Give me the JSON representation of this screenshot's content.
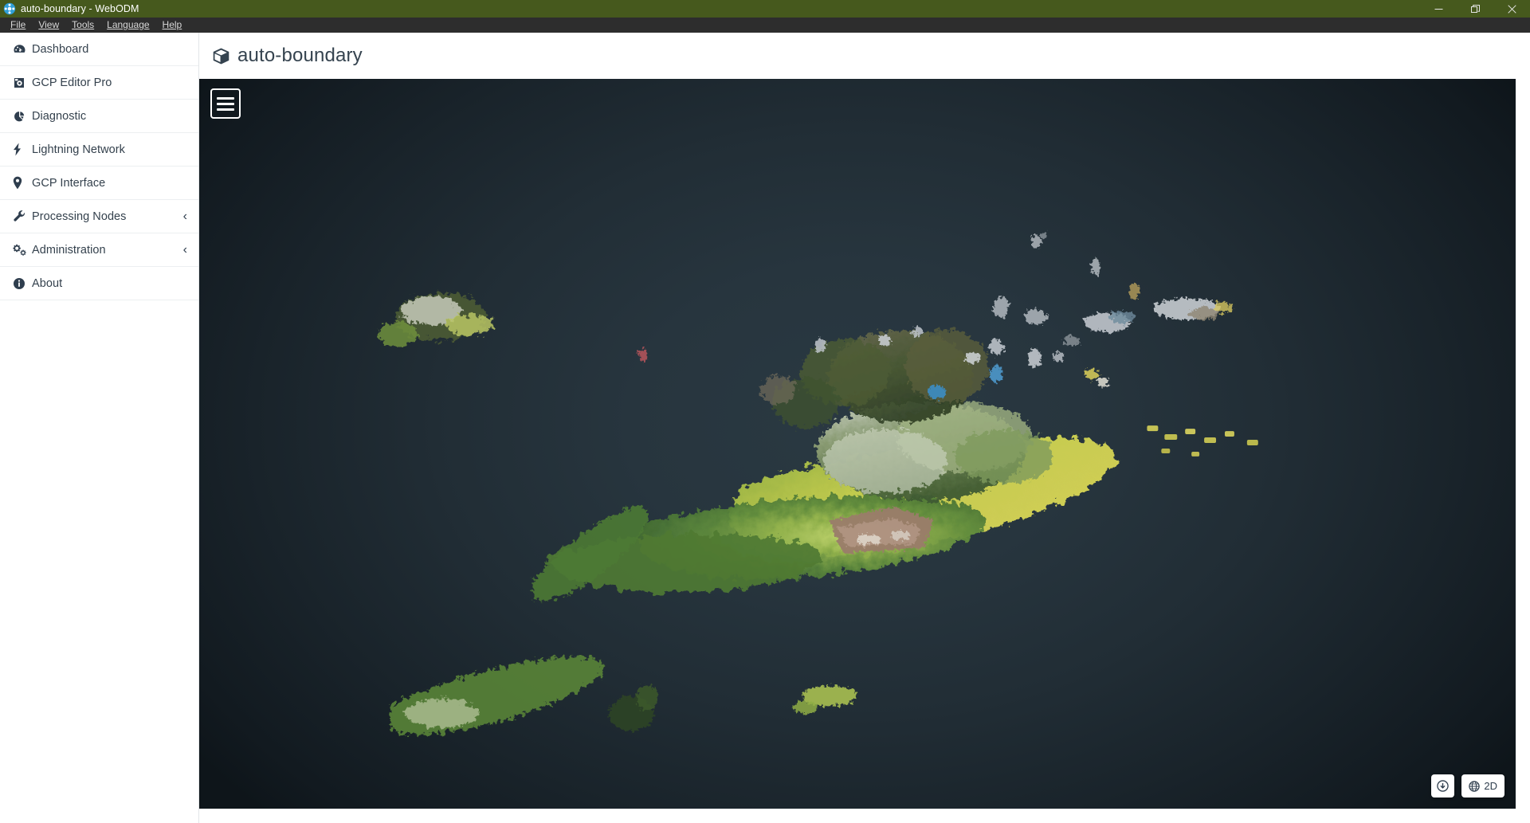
{
  "window": {
    "title": "auto-boundary - WebODM",
    "app_icon": "webodm-logo-icon",
    "controls": {
      "minimize": "minimize-icon",
      "maximize": "restore-icon",
      "close": "close-icon"
    }
  },
  "menubar": {
    "items": [
      {
        "label": "File"
      },
      {
        "label": "View"
      },
      {
        "label": "Tools"
      },
      {
        "label": "Language"
      },
      {
        "label": "Help"
      }
    ]
  },
  "sidebar": {
    "items": [
      {
        "label": "Dashboard",
        "icon": "dashboard-icon",
        "chevron": ""
      },
      {
        "label": "GCP Editor Pro",
        "icon": "gcp-editor-icon",
        "chevron": ""
      },
      {
        "label": "Diagnostic",
        "icon": "pie-chart-icon",
        "chevron": ""
      },
      {
        "label": "Lightning Network",
        "icon": "bolt-icon",
        "chevron": ""
      },
      {
        "label": "GCP Interface",
        "icon": "map-marker-icon",
        "chevron": ""
      },
      {
        "label": "Processing Nodes",
        "icon": "wrench-icon",
        "chevron": "‹"
      },
      {
        "label": "Administration",
        "icon": "cogs-icon",
        "chevron": "‹"
      },
      {
        "label": "About",
        "icon": "info-circle-icon",
        "chevron": ""
      }
    ]
  },
  "page": {
    "title": "auto-boundary",
    "icon": "cube-icon"
  },
  "viewer": {
    "menu_button": "hamburger-menu-icon",
    "buttons": [
      {
        "icon": "download-circle-icon",
        "label": ""
      },
      {
        "icon": "globe-icon",
        "label": "2D"
      }
    ]
  },
  "colors": {
    "titlebar_bg": "#46591d",
    "menubar_bg": "#2d2d2d",
    "sidebar_text": "#34414d",
    "viewer_center": "#2a3942",
    "viewer_edge": "#121a20",
    "accent_white": "#ffffff"
  }
}
